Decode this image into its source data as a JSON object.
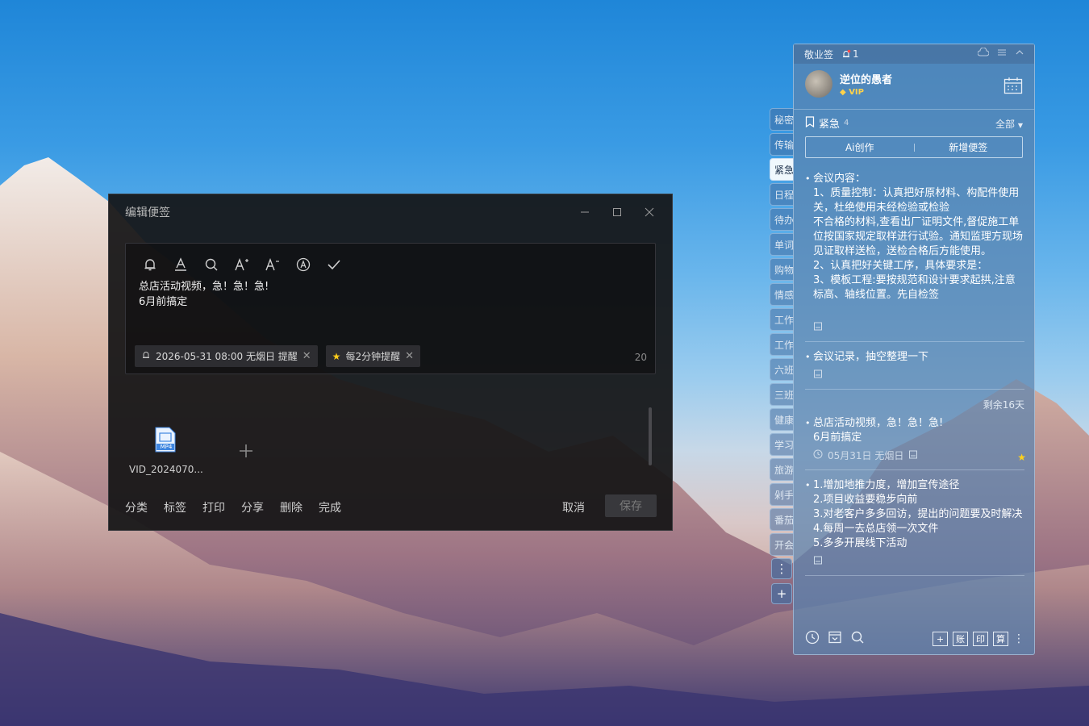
{
  "editor": {
    "title": "编辑便签",
    "text_line1": "总店活动视频，急！急！急!",
    "text_line2": "6月前搞定",
    "reminder_chip": "2026-05-31 08:00 无烟日 提醒",
    "repeat_chip": "每2分钟提醒",
    "char_count": "20",
    "attachment_name": "VID_2024070...",
    "attachment_type": "MP4",
    "actions": [
      "分类",
      "标签",
      "打印",
      "分享",
      "删除",
      "完成"
    ],
    "cancel": "取消",
    "save": "保存"
  },
  "categories": [
    "秘密",
    "传输",
    "紧急",
    "日程",
    "待办",
    "单词",
    "购物",
    "情感",
    "工作",
    "工作",
    "六班",
    "三班",
    "健康",
    "学习",
    "旅游",
    "剁手",
    "番茄",
    "开会"
  ],
  "active_category": "紧急",
  "panel": {
    "app_name": "敬业签",
    "bell_count": "1",
    "user_name": "逆位的愚者",
    "vip": "VIP",
    "category": "紧急",
    "category_count": "4",
    "filter": "全部",
    "ai_button": "Ai创作",
    "add_button": "新增便签",
    "notes": [
      {
        "body": "会议内容：\n1、质量控制：认真把好原材料、构配件使用关，杜绝使用未经检验或检验\n不合格的材料,查看出厂证明文件,督促施工单位按国家规定取样进行试验。通知监理方现场见证取样送检，送检合格后方能使用。\n2、认真把好关键工序，具体要求是：\n3、模板工程:要按规范和设计要求起拱,注意标高、轴线位置。先自检签"
      },
      {
        "body": "会议记录，抽空整理一下"
      },
      {
        "due": "剩余16天",
        "body": "总店活动视频，急！急！急!\n6月前搞定",
        "reminder": "05月31日 无烟日"
      },
      {
        "body": "1.增加地推力度，增加宣传途径\n2.项目收益要稳步向前\n3.对老客户多多回访，提出的问题要及时解决\n4.每周一去总店领一次文件\n5.多多开展线下活动"
      }
    ],
    "bottom_boxes": [
      "账",
      "印",
      "算"
    ]
  }
}
